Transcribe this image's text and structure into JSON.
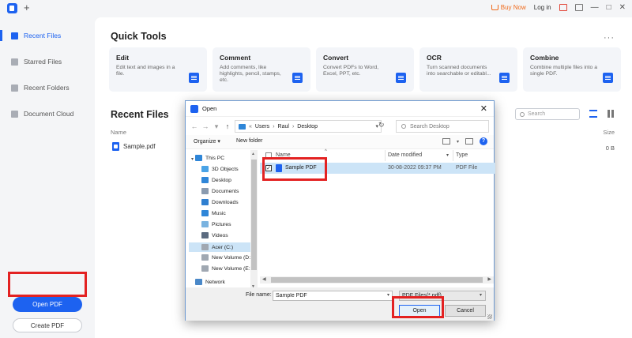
{
  "app": {
    "new_tab": "+",
    "buy_now": "Buy Now",
    "login": "Log in",
    "minimize": "—",
    "restore": "□",
    "close": "✕"
  },
  "sidebar": {
    "items": [
      {
        "label": "Recent Files",
        "active": true
      },
      {
        "label": "Starred Files",
        "active": false
      },
      {
        "label": "Recent Folders",
        "active": false
      },
      {
        "label": "Document Cloud",
        "active": false
      }
    ],
    "open_pdf": "Open PDF",
    "create_pdf": "Create PDF"
  },
  "quick_tools": {
    "title": "Quick Tools",
    "more": "···",
    "cards": [
      {
        "title": "Edit",
        "desc": "Edit text and images in a file."
      },
      {
        "title": "Comment",
        "desc": "Add comments, like highlights, pencil, stamps, etc."
      },
      {
        "title": "Convert",
        "desc": "Convert PDFs to Word, Excel, PPT, etc."
      },
      {
        "title": "OCR",
        "desc": "Turn scanned documents into searchable or editabl..."
      },
      {
        "title": "Combine",
        "desc": "Combine multiple files into a single PDF."
      }
    ]
  },
  "recent_files": {
    "title": "Recent Files",
    "search_placeholder": "Search",
    "col_name": "Name",
    "col_size": "Size",
    "rows": [
      {
        "name": "Sample.pdf",
        "size": "0 B"
      }
    ]
  },
  "dialog": {
    "title": "Open",
    "close": "✕",
    "path": [
      "Users",
      "Raul",
      "Desktop"
    ],
    "path_root_arrow": "«",
    "search_placeholder": "Search Desktop",
    "organize": "Organize ▾",
    "new_folder": "New folder",
    "help": "?",
    "tree": [
      {
        "label": "This PC",
        "icon": "pc"
      },
      {
        "label": "3D Objects",
        "icon": "obj"
      },
      {
        "label": "Desktop",
        "icon": "desk"
      },
      {
        "label": "Documents",
        "icon": "doc"
      },
      {
        "label": "Downloads",
        "icon": "dl"
      },
      {
        "label": "Music",
        "icon": "music"
      },
      {
        "label": "Pictures",
        "icon": "pic"
      },
      {
        "label": "Videos",
        "icon": "vid"
      },
      {
        "label": "Acer (C:)",
        "icon": "drive"
      },
      {
        "label": "New Volume (D:",
        "icon": "drive"
      },
      {
        "label": "New Volume (E:)",
        "icon": "drive"
      },
      {
        "label": "Network",
        "icon": "net"
      }
    ],
    "columns": {
      "name": "Name",
      "date": "Date modified",
      "type": "Type"
    },
    "files": [
      {
        "name": "Sample PDF",
        "date": "30-08-2022 09:37 PM",
        "type": "PDF File",
        "checked": true
      }
    ],
    "file_name_label": "File name:",
    "file_name_value": "Sample PDF",
    "file_type": "PDF Files(*.pdf)",
    "open_button": "Open",
    "cancel_button": "Cancel"
  }
}
